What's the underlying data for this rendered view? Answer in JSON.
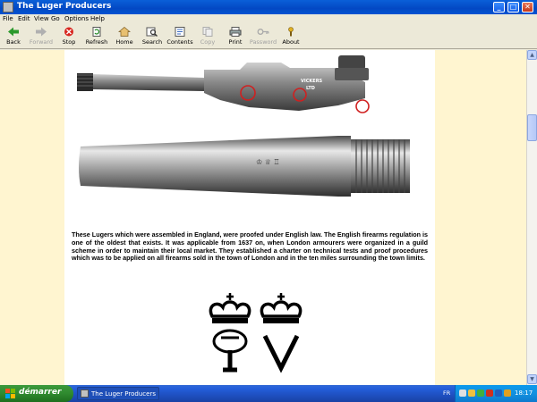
{
  "window": {
    "title": "The Luger Producers"
  },
  "menu": [
    "File",
    "Edit",
    "View",
    "Go",
    "Options",
    "Help"
  ],
  "toolbar": [
    {
      "label": "Back",
      "icon": "back-arrow-icon",
      "enabled": true
    },
    {
      "label": "Forward",
      "icon": "forward-arrow-icon",
      "enabled": false
    },
    {
      "label": "Stop",
      "icon": "stop-icon",
      "enabled": true
    },
    {
      "label": "Refresh",
      "icon": "refresh-icon",
      "enabled": true
    },
    {
      "label": "Home",
      "icon": "home-icon",
      "enabled": true
    },
    {
      "label": "Search",
      "icon": "search-icon",
      "enabled": true
    },
    {
      "label": "Contents",
      "icon": "contents-icon",
      "enabled": true
    },
    {
      "label": "Copy",
      "icon": "copy-icon",
      "enabled": false
    },
    {
      "label": "Print",
      "icon": "print-icon",
      "enabled": true
    },
    {
      "label": "Password",
      "icon": "key-icon",
      "enabled": false
    },
    {
      "label": "About",
      "icon": "about-icon",
      "enabled": true
    }
  ],
  "content": {
    "gun_marking": "VICKERS\nLTD",
    "paragraph": "These Lugers which were assembled in England, were proofed under English law. The English firearms regulation is one of the oldest that exists. It was applicable from 1637 on, when London armourers were organized in a guild scheme in order to maintain their local market. They established a charter on technical tests and proof procedures which was to be applied on all firearms sold in the town of London and in the ten miles surrounding the town limits.",
    "proof_marks": [
      {
        "letters": "GP",
        "icon": "crown-icon"
      },
      {
        "letters": "V",
        "icon": "crown-icon"
      }
    ]
  },
  "taskbar": {
    "start_label": "démarrer",
    "task_label": "The Luger Producers",
    "language": "FR",
    "clock": "18:17"
  },
  "colors": {
    "titlebar": "#0348c4",
    "content_bg": "#fff5d0",
    "start_green": "#2f8a2f",
    "taskbar_blue": "#245edb",
    "marking_circle": "#d02020"
  }
}
